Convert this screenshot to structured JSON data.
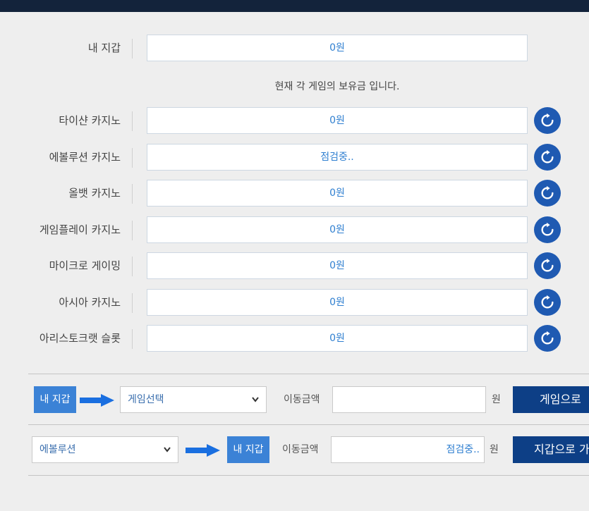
{
  "wallet": {
    "label": "내 지갑",
    "value": "0원"
  },
  "notice": "현재 각 게임의 보유금 입니다.",
  "games": [
    {
      "label": "타이샨 카지노",
      "value": "0원"
    },
    {
      "label": "에볼루션 카지노",
      "value": "점검중.."
    },
    {
      "label": "올뱃 카지노",
      "value": "0원"
    },
    {
      "label": "게임플레이 카지노",
      "value": "0원"
    },
    {
      "label": "마이크로 게이밍",
      "value": "0원"
    },
    {
      "label": "아시아 카지노",
      "value": "0원"
    },
    {
      "label": "아리스토크랫 슬롯",
      "value": "0원"
    }
  ],
  "to_game": {
    "wallet_label": "내 지갑",
    "select_value": "게임선택",
    "amount_label": "이동금액",
    "amount_value": "",
    "unit": "원",
    "button_label": "게임으로"
  },
  "to_wallet": {
    "select_value": "에볼루션",
    "wallet_label": "내 지갑",
    "amount_label": "이동금액",
    "amount_value": "점검중..",
    "unit": "원",
    "button_label": "지갑으로 가"
  },
  "colors": {
    "topbar": "#13233b",
    "refresh": "#1f5ab2",
    "wallet_tag": "#3b82d6",
    "action_button": "#0d3f86",
    "value_text": "#2f7fd0"
  },
  "icons": {
    "refresh": "refresh-icon",
    "arrow": "arrow-right-icon",
    "dropdown": "chevron-down-icon"
  }
}
